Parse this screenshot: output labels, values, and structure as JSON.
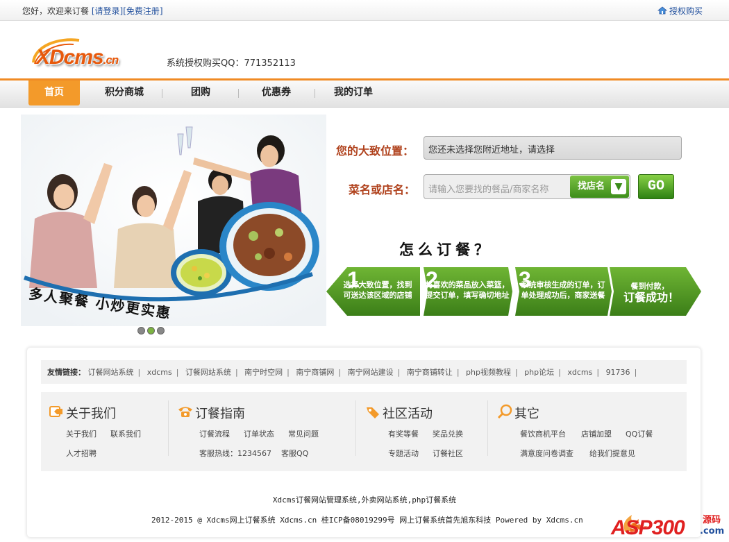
{
  "topbar": {
    "welcome": "您好，欢迎来订餐",
    "login": "[请登录]",
    "register": "[免费注册]",
    "auth_buy": "授权购买"
  },
  "header": {
    "logo_text": "XDcms",
    "logo_suffix": ".cn",
    "qq_text": "系统授权购买QQ：771352113"
  },
  "nav": {
    "items": [
      "首页",
      "积分商城",
      "团购",
      "优惠券",
      "我的订单"
    ]
  },
  "banner": {
    "slogan": "多人聚餐 小炒更实惠",
    "slides": 3,
    "active_slide": 2
  },
  "search": {
    "location_label": "您的大致位置：",
    "location_value": "您还未选择您附近地址，请选择",
    "keyword_label": "菜名或店名：",
    "keyword_placeholder": "请输入您要找的餐品/商家名称",
    "find_button": "找店名",
    "go_button": "GO"
  },
  "how": {
    "title": "怎么订餐？",
    "steps": [
      {
        "num": "1",
        "text": "选择大致位置，找到可送达该区域的店铺"
      },
      {
        "num": "2",
        "text": "将喜欢的菜品放入菜篮，提交订单，填写确切地址"
      },
      {
        "num": "3",
        "text": "系统审核生成的订单，订单处理成功后，商家送餐"
      },
      {
        "num": "",
        "text_small": "餐到付款，",
        "text_big": "订餐成功！"
      }
    ]
  },
  "friend_links": {
    "label": "友情链接：",
    "items": [
      "订餐网站系统",
      "xdcms",
      "订餐网站系统",
      "南宁时空网",
      "南宁商铺网",
      "南宁网站建设",
      "南宁商铺转让",
      "php视频教程",
      "php论坛",
      "xdcms",
      "91736"
    ]
  },
  "columns": [
    {
      "title": "关于我们",
      "icon": "about-icon",
      "links": [
        "关于我们",
        "联系我们",
        "人才招聘"
      ]
    },
    {
      "title": "订餐指南",
      "icon": "phone-icon",
      "links": [
        "订餐流程",
        "订单状态",
        "常见问题",
        "客服热线：1234567",
        "客服QQ"
      ]
    },
    {
      "title": "社区活动",
      "icon": "tag-icon",
      "links": [
        "有奖等餐",
        "奖品兑换",
        "专题活动",
        "订餐社区"
      ]
    },
    {
      "title": "其它",
      "icon": "magnifier-icon",
      "links": [
        "餐饮商机平台",
        "店铺加盟",
        "QQ订餐",
        "满意度问卷调查",
        "给我们提意见"
      ]
    }
  ],
  "footer": {
    "line1": "Xdcms订餐网站管理系统,外卖网站系统,php订餐系统",
    "line2": "2012-2015 @ Xdcms网上订餐系统 Xdcms.cn 桂ICP备08019299号 网上订餐系统首先旭东科技 Powered by Xdcms.cn",
    "watermark": "ASP300",
    "watermark_suffix": "源码",
    "watermark_domain": ".com"
  },
  "colors": {
    "accent_orange": "#f39a2a",
    "label_red": "#b0421d",
    "link_blue": "#1f4e9c",
    "green": "#3d8d1a"
  }
}
